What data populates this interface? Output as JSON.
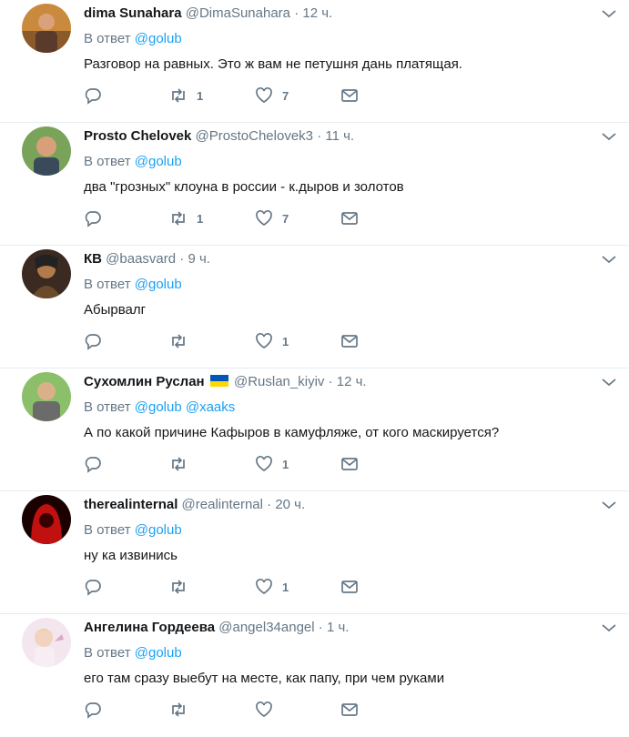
{
  "reply_prefix": "В ответ",
  "tweets": [
    {
      "name": "dima Sunahara",
      "handle": "@DimaSunahara",
      "time": "12 ч.",
      "reply_to": "@golub",
      "reply_to_2": "",
      "text": "Разговор на равных. Это ж вам не петушня дань платящая.",
      "retweets": "1",
      "likes": "7",
      "avatar_colors": [
        "#c98a3d",
        "#5a3a2a"
      ]
    },
    {
      "name": "Prosto Chelovek",
      "handle": "@ProstoChelovek3",
      "time": "11 ч.",
      "reply_to": "@golub",
      "reply_to_2": "",
      "text": "два \"грозных\" клоуна в россии - к.дыров и золотов",
      "retweets": "1",
      "likes": "7",
      "avatar_colors": [
        "#7aa35a",
        "#d8a07a"
      ]
    },
    {
      "name": "КВ",
      "handle": "@baasvard",
      "time": "9 ч.",
      "reply_to": "@golub",
      "reply_to_2": "",
      "text": "Абырвалг",
      "retweets": "",
      "likes": "1",
      "avatar_colors": [
        "#3a2a22",
        "#b07a4a"
      ]
    },
    {
      "name": "Сухомлин Руслан",
      "handle": "@Ruslan_kiyiv",
      "time": "12 ч.",
      "reply_to": "@golub",
      "reply_to_2": "@xaaks",
      "text": "А по какой причине Кафыров в камуфляже, от кого маскируется?",
      "retweets": "",
      "likes": "1",
      "avatar_colors": [
        "#8bbf6a",
        "#6b6b6b"
      ],
      "flag_colors": [
        "#0057b7",
        "#ffd700"
      ]
    },
    {
      "name": "therealinternal",
      "handle": "@realinternal",
      "time": "20 ч.",
      "reply_to": "@golub",
      "reply_to_2": "",
      "text": "ну ка извинись",
      "retweets": "",
      "likes": "1",
      "avatar_colors": [
        "#1a0000",
        "#c01010"
      ]
    },
    {
      "name": "Ангелина Гордеева",
      "handle": "@angel34angel",
      "time": "1 ч.",
      "reply_to": "@golub",
      "reply_to_2": "",
      "text": "его там сразу выебут на месте, как папу, при чем руками",
      "retweets": "",
      "likes": "",
      "avatar_colors": [
        "#f3e6ef",
        "#d9a8c4"
      ]
    }
  ]
}
